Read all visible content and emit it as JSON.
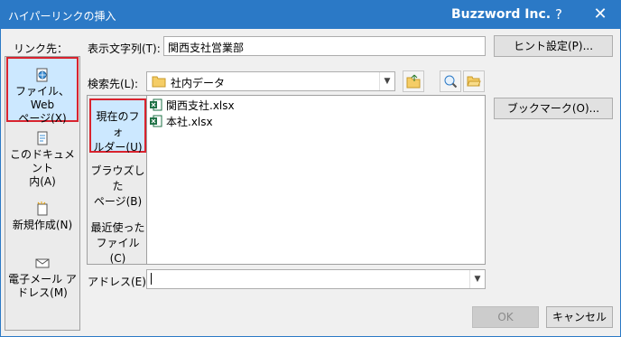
{
  "window": {
    "title": "ハイパーリンクの挿入",
    "brand": "Buzzword Inc.",
    "help": "?",
    "close": "✕"
  },
  "link_to": {
    "label": "リンク先：",
    "items": [
      {
        "label_line1": "ファイル、Web",
        "label_line2": "ページ(X)",
        "icon": "globe-file-icon",
        "selected": true
      },
      {
        "label_line1": "このドキュメント",
        "label_line2": "内(A)",
        "icon": "document-place-icon",
        "selected": false
      },
      {
        "label_line1": "新規作成(N)",
        "label_line2": "",
        "icon": "new-document-icon",
        "selected": false
      },
      {
        "label_line1": "電子メール ア",
        "label_line2": "ドレス(M)",
        "icon": "email-icon",
        "selected": false
      }
    ]
  },
  "display_text": {
    "label": "表示文字列(T):",
    "value": "関西支社営業部"
  },
  "screen_tip_button": "ヒント設定(P)...",
  "look_in": {
    "label": "検索先(L):",
    "value": "社内データ"
  },
  "nav": {
    "items": [
      {
        "line1": "現在のフォ",
        "line2": "ルダー(U)",
        "selected": true
      },
      {
        "line1": "ブラウズした",
        "line2": "ページ(B)",
        "selected": false
      },
      {
        "line1": "最近使った",
        "line2": "ファイル(C)",
        "selected": false
      }
    ]
  },
  "files": [
    "関西支社.xlsx",
    "本社.xlsx"
  ],
  "bookmark_button": "ブックマーク(O)...",
  "address": {
    "label": "アドレス(E):",
    "value": ""
  },
  "ok_button": "OK",
  "cancel_button": "キャンセル",
  "colors": {
    "titlebar": "#2b79c6",
    "selection": "#cce8ff",
    "highlight_border": "#d9232e",
    "excel_green": "#1e7145"
  }
}
